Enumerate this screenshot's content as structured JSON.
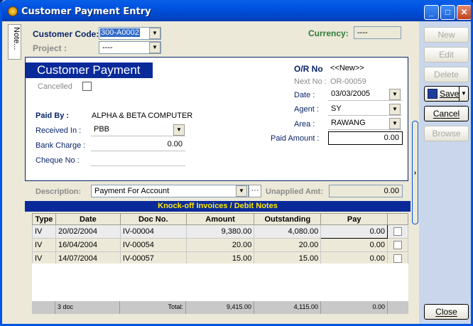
{
  "window": {
    "title": "Customer Payment Entry"
  },
  "note_tab": "Note...",
  "header": {
    "customer_code_label": "Customer Code:",
    "customer_code_value": "300-A0002",
    "project_label": "Project :",
    "project_value": "----",
    "currency_label": "Currency:",
    "currency_value": "----"
  },
  "payment": {
    "title": "Customer Payment",
    "cancelled_label": "Cancelled",
    "or_no_label": "O/R No",
    "or_no_value": "<<New>>",
    "next_no_label": "Next No :",
    "next_no_value": "OR-00059",
    "date_label": "Date :",
    "date_value": "03/03/2005",
    "agent_label": "Agent :",
    "agent_value": "SY",
    "area_label": "Area :",
    "area_value": "RAWANG",
    "paid_amount_label": "Paid Amount :",
    "paid_amount_value": "0.00",
    "paid_by_label": "Paid By :",
    "paid_by_value": "ALPHA & BETA COMPUTER",
    "received_in_label": "Received In :",
    "received_in_value": "PBB",
    "bank_charge_label": "Bank Charge :",
    "bank_charge_value": "0.00",
    "cheque_no_label": "Cheque No :",
    "cheque_no_value": ""
  },
  "description": {
    "label": "Description:",
    "value": "Payment For Account",
    "more_button": "···",
    "unapplied_label": "Unapplied Amt:",
    "unapplied_value": "0.00"
  },
  "knockoff": {
    "title": "Knock-off Invoices / Debit Notes",
    "columns": [
      "Type",
      "Date",
      "Doc No.",
      "Amount",
      "Outstanding",
      "Pay",
      ""
    ],
    "rows": [
      {
        "type": "IV",
        "date": "20/02/2004",
        "doc_no": "IV-00004",
        "amount": "9,380.00",
        "outstanding": "4,080.00",
        "pay": "0.00"
      },
      {
        "type": "IV",
        "date": "16/04/2004",
        "doc_no": "IV-00054",
        "amount": "20.00",
        "outstanding": "20.00",
        "pay": "0.00"
      },
      {
        "type": "IV",
        "date": "14/07/2004",
        "doc_no": "IV-00057",
        "amount": "15.00",
        "outstanding": "15.00",
        "pay": "0.00"
      }
    ],
    "footer": {
      "count": "3 doc",
      "total_label": "Total:",
      "amount_total": "9,415.00",
      "outstanding_total": "4,115.00",
      "pay_total": "0.00"
    }
  },
  "buttons": {
    "new": "New",
    "edit": "Edit",
    "delete": "Delete",
    "save": "Save",
    "cancel": "Cancel",
    "browse": "Browse",
    "close": "Close"
  },
  "colors": {
    "title_bar": "#0054e3",
    "panel_header": "#0a2a9a",
    "label": "#0a246a",
    "currency_label": "#2d7a3a"
  }
}
